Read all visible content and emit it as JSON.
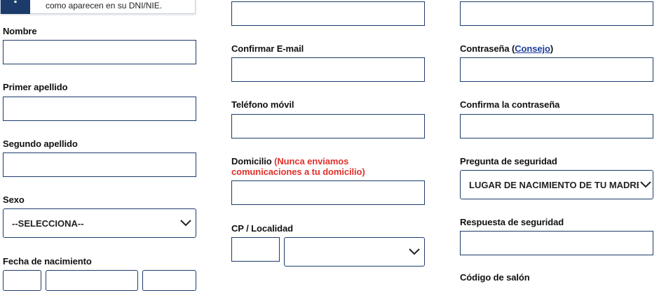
{
  "notice": {
    "icon": "exclamation-icon",
    "icon_glyph": "!",
    "text": "como aparecen en su DNI/NIE."
  },
  "left": {
    "nombre_label": "Nombre",
    "primer_apellido_label": "Primer apellido",
    "segundo_apellido_label": "Segundo apellido",
    "sexo_label": "Sexo",
    "sexo_value": "--SELECCIONA--",
    "fecha_label": "Fecha de nacimiento"
  },
  "middle": {
    "confirmar_email_label": "Confirmar E-mail",
    "telefono_label": "Teléfono móvil",
    "domicilio_label": "Domicilio",
    "domicilio_note_line1": "(Nunca enviamos",
    "domicilio_note_line2": "comunicaciones a tu domicilio)",
    "cp_localidad_label": "CP / Localidad",
    "localidad_value": ""
  },
  "right": {
    "contrasena_label_prefix": "Contraseña (",
    "contrasena_link": "Consejo",
    "contrasena_label_suffix": ")",
    "confirma_contrasena_label": "Confirma la contraseña",
    "pregunta_label": "Pregunta de seguridad",
    "pregunta_value": "LUGAR DE NACIMIENTO DE TU MADRE",
    "respuesta_label": "Respuesta de seguridad",
    "codigo_salon_label": "Código de salón"
  },
  "colors": {
    "field_border": "#1c3b6b",
    "note_red": "#e0312b",
    "link_blue": "#1c3b9b"
  }
}
